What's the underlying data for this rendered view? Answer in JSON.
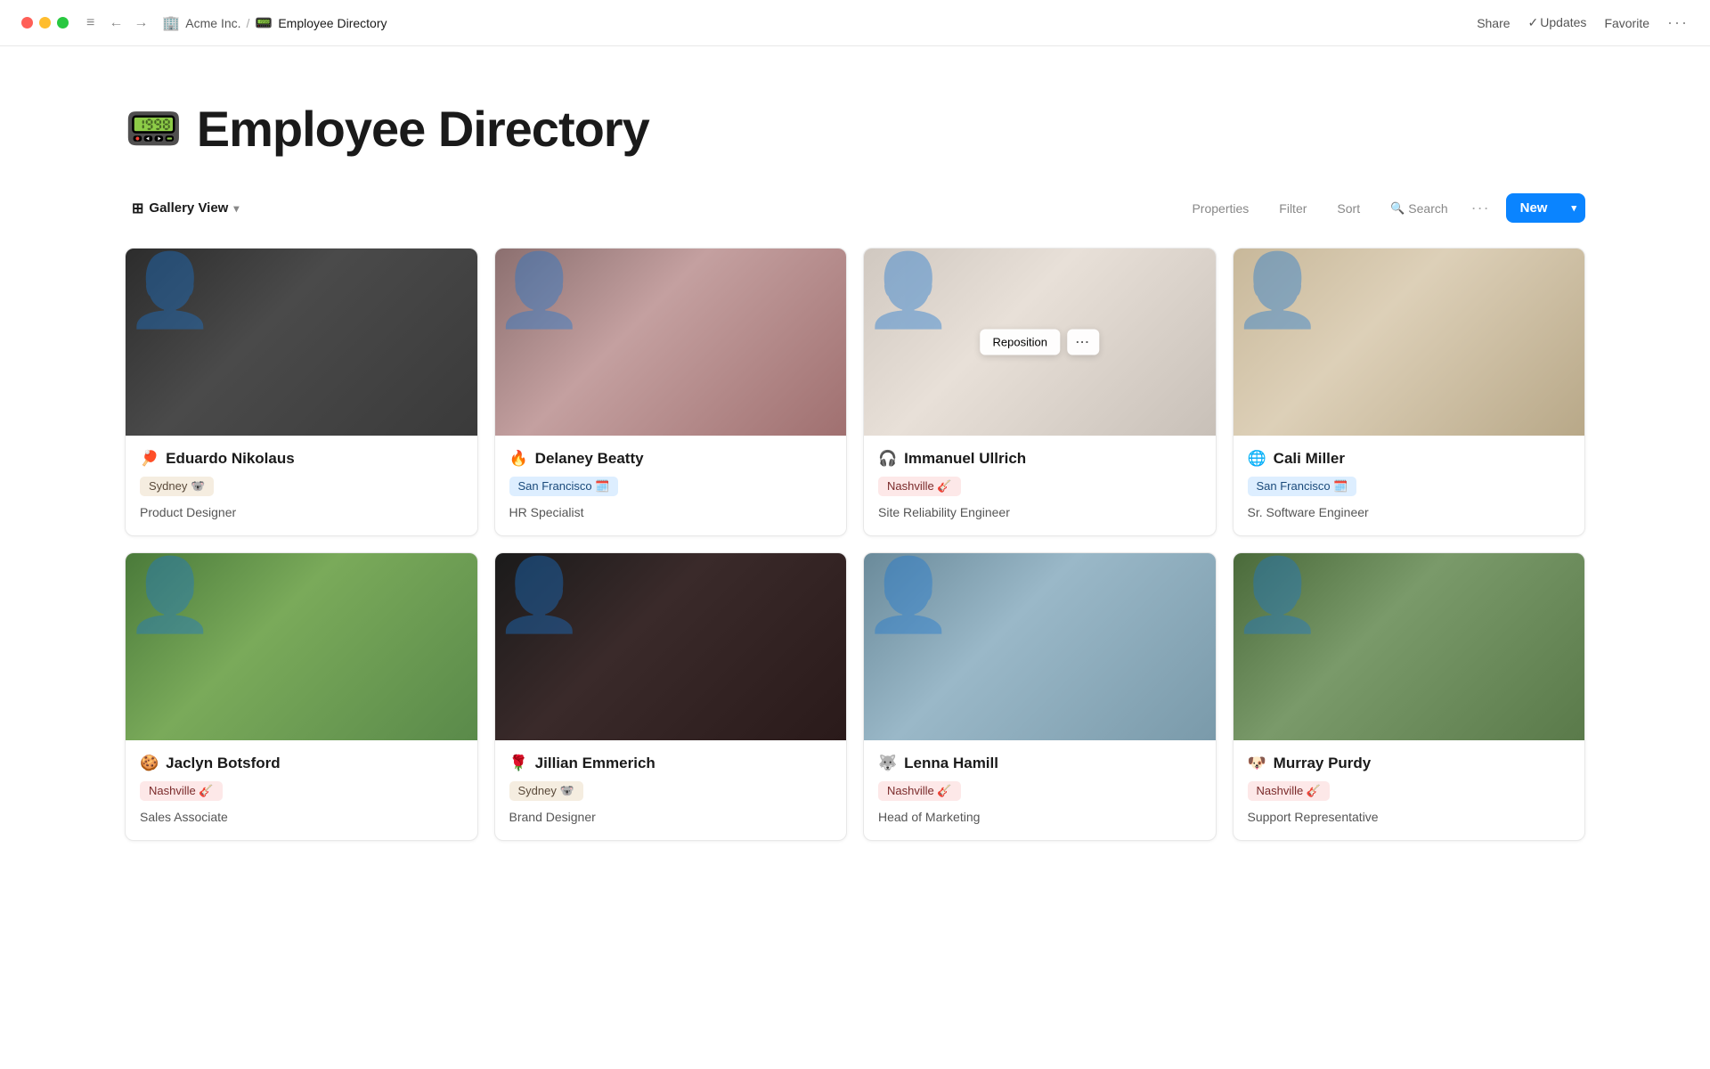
{
  "titlebar": {
    "traffic": [
      "red",
      "yellow",
      "green"
    ],
    "nav": [
      "←",
      "→"
    ],
    "company": "Acme Inc.",
    "sep": "/",
    "page_icon": "📟",
    "page_title": "Employee Directory",
    "actions": {
      "share": "Share",
      "updates": "Updates",
      "favorite": "Favorite",
      "more": "···"
    }
  },
  "page": {
    "icon": "📟",
    "title": "Employee Directory",
    "toolbar": {
      "view_icon": "⊞",
      "view_label": "Gallery View",
      "chevron": "▾",
      "properties": "Properties",
      "filter": "Filter",
      "sort": "Sort",
      "search_icon": "🔍",
      "search": "Search",
      "more": "···",
      "new_label": "New",
      "new_arrow": "▾"
    },
    "employees": [
      {
        "id": "eduardo",
        "name_icon": "🏓",
        "name": "Eduardo Nikolaus",
        "location_tag": "Sydney 🐨",
        "tag_class": "tag-sydney",
        "role": "Product Designer",
        "photo_class": "photo-eduardo",
        "reposition": false
      },
      {
        "id": "delaney",
        "name_icon": "🔥",
        "name": "Delaney Beatty",
        "location_tag": "San Francisco 🗓️",
        "tag_class": "tag-sf",
        "role": "HR Specialist",
        "photo_class": "photo-delaney",
        "reposition": false
      },
      {
        "id": "immanuel",
        "name_icon": "🎧",
        "name": "Immanuel Ullrich",
        "location_tag": "Nashville 🎸",
        "tag_class": "tag-nashville",
        "role": "Site Reliability Engineer",
        "photo_class": "photo-immanuel",
        "reposition": true
      },
      {
        "id": "cali",
        "name_icon": "🌐",
        "name": "Cali Miller",
        "location_tag": "San Francisco 🗓️",
        "tag_class": "tag-sf",
        "role": "Sr. Software Engineer",
        "photo_class": "photo-cali",
        "reposition": false
      },
      {
        "id": "jaclyn",
        "name_icon": "🍪",
        "name": "Jaclyn Botsford",
        "location_tag": "Nashville 🎸",
        "tag_class": "tag-nashville",
        "role": "Sales Associate",
        "photo_class": "photo-jaclyn",
        "reposition": false
      },
      {
        "id": "jillian",
        "name_icon": "🌹",
        "name": "Jillian Emmerich",
        "location_tag": "Sydney 🐨",
        "tag_class": "tag-sydney",
        "role": "Brand Designer",
        "photo_class": "photo-jillian",
        "reposition": false
      },
      {
        "id": "lenna",
        "name_icon": "🐺",
        "name": "Lenna Hamill",
        "location_tag": "Nashville 🎸",
        "tag_class": "tag-nashville",
        "role": "Head of Marketing",
        "photo_class": "photo-lenna",
        "reposition": false
      },
      {
        "id": "murray",
        "name_icon": "🐶",
        "name": "Murray Purdy",
        "location_tag": "Nashville 🎸",
        "tag_class": "tag-nashville",
        "role": "Support Representative",
        "photo_class": "photo-murray",
        "reposition": false
      }
    ]
  }
}
